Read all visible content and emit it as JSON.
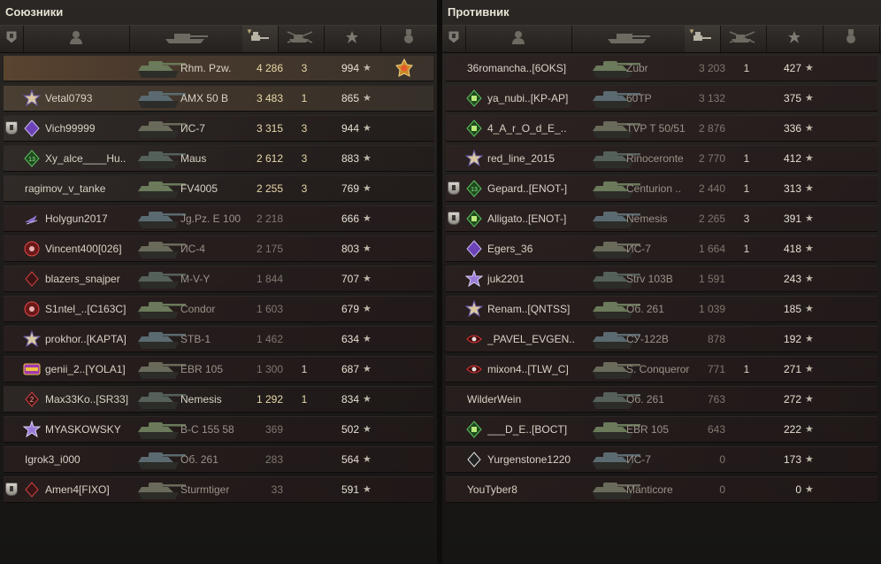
{
  "allies": {
    "title": "Союзники",
    "players": [
      {
        "player": "",
        "clan": "",
        "vehicle": "Rhm. Pzw.",
        "damage": "4 286",
        "kills": "3",
        "xp": "994",
        "rank_badge": false,
        "icon": "none",
        "medal": true,
        "alive": true,
        "highlight": "top"
      },
      {
        "player": "Vetal0793",
        "clan": "",
        "vehicle": "AMX 50 B",
        "damage": "3 483",
        "kills": "1",
        "xp": "865",
        "rank_badge": false,
        "icon": "gold-star",
        "alive": true,
        "highlight": "self"
      },
      {
        "player": "Vich99999",
        "clan": "",
        "vehicle": "ИС-7",
        "damage": "3 315",
        "kills": "3",
        "xp": "944",
        "rank_badge": true,
        "icon": "purple-diamond",
        "alive": true
      },
      {
        "player": "Xy_alce____Hu..",
        "clan": "",
        "vehicle": "Maus",
        "damage": "2 612",
        "kills": "3",
        "xp": "883",
        "rank_badge": false,
        "icon": "green-13",
        "alive": true
      },
      {
        "player": "ragimov_v_tanke",
        "clan": "",
        "vehicle": "FV4005",
        "damage": "2 255",
        "kills": "3",
        "xp": "769",
        "rank_badge": false,
        "icon": "none",
        "alive": true
      },
      {
        "player": "Holygun2017",
        "clan": "",
        "vehicle": "Jg.Pz. E 100",
        "damage": "2 218",
        "kills": "",
        "xp": "666",
        "rank_badge": false,
        "icon": "wing",
        "alive": false
      },
      {
        "player": "Vincent400",
        "clan": "[026]",
        "vehicle": "ИС-4",
        "damage": "2 175",
        "kills": "",
        "xp": "803",
        "rank_badge": false,
        "icon": "red-circle",
        "alive": false
      },
      {
        "player": "blazers_snajper",
        "clan": "",
        "vehicle": "M-V-Y",
        "damage": "1 844",
        "kills": "",
        "xp": "707",
        "rank_badge": false,
        "icon": "red-diamond",
        "alive": false
      },
      {
        "player": "S1ntel_..",
        "clan": "[C163C]",
        "vehicle": "Condor",
        "damage": "1 603",
        "kills": "",
        "xp": "679",
        "rank_badge": false,
        "icon": "red-circle",
        "alive": false
      },
      {
        "player": "prokhor..",
        "clan": "[KAPTA]",
        "vehicle": "STB-1",
        "damage": "1 462",
        "kills": "",
        "xp": "634",
        "rank_badge": false,
        "icon": "gold-star",
        "alive": false
      },
      {
        "player": "genii_2..",
        "clan": "[YOLA1]",
        "vehicle": "EBR 105",
        "damage": "1 300",
        "kills": "1",
        "xp": "687",
        "rank_badge": false,
        "icon": "legend",
        "alive": false
      },
      {
        "player": "Max33Ko..",
        "clan": "[SR33]",
        "vehicle": "Nemesis",
        "damage": "1 292",
        "kills": "1",
        "xp": "834",
        "rank_badge": false,
        "icon": "red-2",
        "alive": true
      },
      {
        "player": "MYASKOWSKY",
        "clan": "",
        "vehicle": "B-C 155 58",
        "damage": "369",
        "kills": "",
        "xp": "502",
        "rank_badge": false,
        "icon": "purple-star",
        "alive": false
      },
      {
        "player": "Igrok3_i000",
        "clan": "",
        "vehicle": "Об. 261",
        "damage": "283",
        "kills": "",
        "xp": "564",
        "rank_badge": false,
        "icon": "none",
        "alive": false
      },
      {
        "player": "Amen4",
        "clan": "[FIXO]",
        "vehicle": "Sturmtiger",
        "damage": "33",
        "kills": "",
        "xp": "591",
        "rank_badge": true,
        "icon": "red-diamond",
        "alive": false
      }
    ]
  },
  "enemies": {
    "title": "Противник",
    "players": [
      {
        "player": "36romancha..",
        "clan": "[6OKS]",
        "vehicle": "Zubr",
        "damage": "3 203",
        "kills": "1",
        "xp": "427",
        "rank_badge": false,
        "icon": "none",
        "alive": false
      },
      {
        "player": "ya_nubi..",
        "clan": "[KP-AP]",
        "vehicle": "60TP",
        "damage": "3 132",
        "kills": "",
        "xp": "375",
        "rank_badge": false,
        "icon": "green-house",
        "alive": false
      },
      {
        "player": "4_A_r_O_d_E_..",
        "clan": "",
        "vehicle": "TVP T 50/51",
        "damage": "2 876",
        "kills": "",
        "xp": "336",
        "rank_badge": false,
        "icon": "green-house",
        "alive": false
      },
      {
        "player": "red_line_2015",
        "clan": "",
        "vehicle": "Rinoceronte",
        "damage": "2 770",
        "kills": "1",
        "xp": "412",
        "rank_badge": false,
        "icon": "gold-star",
        "alive": false
      },
      {
        "player": "Gepard..",
        "clan": "[ENOT-]",
        "vehicle": "Centurion ..",
        "damage": "2 440",
        "kills": "1",
        "xp": "313",
        "rank_badge": true,
        "icon": "green-13",
        "alive": false
      },
      {
        "player": "Alligato..",
        "clan": "[ENOT-]",
        "vehicle": "Nemesis",
        "damage": "2 265",
        "kills": "3",
        "xp": "391",
        "rank_badge": true,
        "icon": "green-house",
        "alive": false
      },
      {
        "player": "Egers_36",
        "clan": "",
        "vehicle": "ИС-7",
        "damage": "1 664",
        "kills": "1",
        "xp": "418",
        "rank_badge": false,
        "icon": "purple-diamond",
        "alive": false
      },
      {
        "player": "juk2201",
        "clan": "",
        "vehicle": "Strv 103B",
        "damage": "1 591",
        "kills": "",
        "xp": "243",
        "rank_badge": false,
        "icon": "purple-star",
        "alive": false
      },
      {
        "player": "Renam..",
        "clan": "[QNTSS]",
        "vehicle": "Об. 261",
        "damage": "1 039",
        "kills": "",
        "xp": "185",
        "rank_badge": false,
        "icon": "gold-star",
        "alive": false
      },
      {
        "player": "_PAVEL_EVGEN..",
        "clan": "",
        "vehicle": "СУ-122В",
        "damage": "878",
        "kills": "",
        "xp": "192",
        "rank_badge": false,
        "icon": "red-eye",
        "alive": false
      },
      {
        "player": "mixon4..",
        "clan": "[TLW_C]",
        "vehicle": "S. Conqueror",
        "damage": "771",
        "kills": "1",
        "xp": "271",
        "rank_badge": false,
        "icon": "red-eye",
        "alive": false
      },
      {
        "player": "WilderWein",
        "clan": "",
        "vehicle": "Об. 261",
        "damage": "763",
        "kills": "",
        "xp": "272",
        "rank_badge": false,
        "icon": "none",
        "alive": false
      },
      {
        "player": "___D_E..",
        "clan": "[BOCT]",
        "vehicle": "EBR 105",
        "damage": "643",
        "kills": "",
        "xp": "222",
        "rank_badge": false,
        "icon": "green-house",
        "alive": false
      },
      {
        "player": "Yurgenstone1220",
        "clan": "",
        "vehicle": "ИС-7",
        "damage": "0",
        "kills": "",
        "xp": "173",
        "rank_badge": false,
        "icon": "white-diamond",
        "alive": false
      },
      {
        "player": "YouTyber8",
        "clan": "",
        "vehicle": "Manticore",
        "damage": "0",
        "kills": "",
        "xp": "0",
        "rank_badge": false,
        "icon": "none",
        "alive": false
      }
    ]
  },
  "header": {
    "columns": [
      "rank-badge-icon",
      "player-icon",
      "vehicle-icon",
      "damage-icon",
      "kills-icon",
      "xp-star-icon",
      "medal-icon"
    ],
    "sorted_column": "damage"
  },
  "colors": {
    "accent": "#e8d8a8",
    "text": "#d8d2c4",
    "dim": "#8d877c",
    "panel": "#1b1918"
  },
  "star_glyph": "★"
}
